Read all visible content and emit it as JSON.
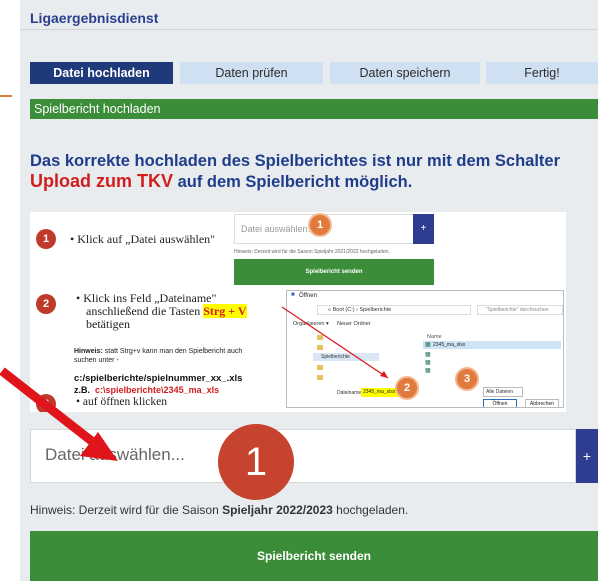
{
  "app": {
    "title": "Ligaergebnisdienst"
  },
  "steps": [
    {
      "label": "Datei hochladen",
      "active": true
    },
    {
      "label": "Daten prüfen",
      "active": false
    },
    {
      "label": "Daten speichern",
      "active": false
    },
    {
      "label": "Fertig!",
      "active": false
    }
  ],
  "section_header": "Spielbericht hochladen",
  "notice": {
    "line1": "Das korrekte hochladen des Spielberichtes ist nur mit dem Schalter",
    "highlight": "Upload zum TKV",
    "line2_rest": " auf dem Spielbericht möglich."
  },
  "instructions": {
    "step1_text": "• Klick auf „Datei auswählen\"",
    "step2_text_a": "• Klick ins Feld „Dateiname\"",
    "step2_text_b": "anschließend die Tasten",
    "step2_keys": "Strg + V",
    "step2_text_c": "betätigen",
    "hint_label": "Hinweis:",
    "hint_text": "statt Strg+v kann man den Spielbericht auch suchen unter -",
    "path": "c:/spielberichte/spielnummer_xx_.xls",
    "example_label": "z.B.",
    "example_path": "c:\\spielberichte\\2345_ma_xls",
    "step3_text": "• auf öffnen klicken",
    "badge1": "1",
    "badge2": "2",
    "badge3": "3",
    "mini_upload": {
      "placeholder": "Datei auswählen...",
      "plus": "+",
      "hint": "Hinweis: Derzeit wird für die Saison Spieljahr 2021/2022 hochgeladen.",
      "button": "Spielbericht senden"
    },
    "dialog": {
      "title": "Öffnen",
      "breadcrumb": "« Boot (C:) › Spielberichte",
      "search": "\"Spielberichte\" durchsuchen",
      "organize": "Organisieren ▾",
      "new_folder": "Neuer Ordner",
      "column_name": "Name",
      "selected_file": "2345_ma_xlsx",
      "folder": "Spielberichte",
      "filename_label": "Dateiname:",
      "filename_value": "2345_ma_xlsx",
      "filter": "Alle Dateien",
      "open": "Öffnen",
      "cancel": "Abbrechen"
    }
  },
  "upload": {
    "placeholder": "Datei auswählen...",
    "plus": "+",
    "badge": "1"
  },
  "season_hint": {
    "prefix": "Hinweis: Derzeit wird für die Saison ",
    "season": "Spieljahr 2022/2023",
    "suffix": " hochgeladen."
  },
  "submit_label": "Spielbericht senden",
  "colors": {
    "navy": "#1e3a7b",
    "green": "#3c8d3a",
    "red": "#d21e1e",
    "light_blue": "#cfe0f2",
    "arrow": "#e0151b"
  }
}
